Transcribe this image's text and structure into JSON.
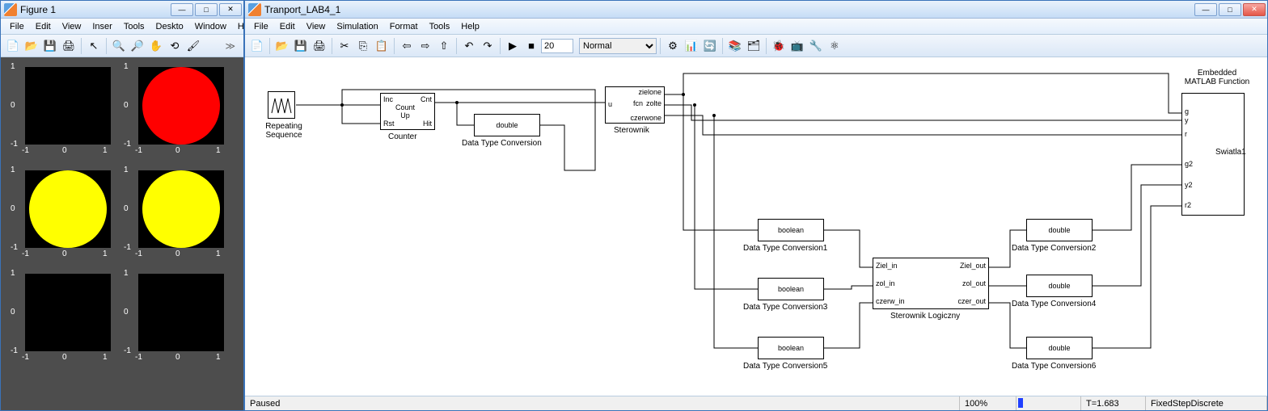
{
  "figure": {
    "title": "Figure 1",
    "menu": [
      "File",
      "Edit",
      "View",
      "Inser",
      "Tools",
      "Deskto",
      "Window",
      "Help"
    ],
    "ticks": {
      "x": [
        "-1",
        "0",
        "1"
      ],
      "y": [
        "-1",
        "0",
        "1"
      ]
    },
    "plots": [
      {
        "row": 0,
        "col": 0,
        "fill": "none"
      },
      {
        "row": 0,
        "col": 1,
        "fill": "#ff0000"
      },
      {
        "row": 1,
        "col": 0,
        "fill": "#ffff00"
      },
      {
        "row": 1,
        "col": 1,
        "fill": "#ffff00"
      },
      {
        "row": 2,
        "col": 0,
        "fill": "none"
      },
      {
        "row": 2,
        "col": 1,
        "fill": "none"
      }
    ]
  },
  "simulink": {
    "title": "Tranport_LAB4_1",
    "menu": [
      "File",
      "Edit",
      "View",
      "Simulation",
      "Format",
      "Tools",
      "Help"
    ],
    "stoptime": "20",
    "mode": "Normal",
    "status": {
      "state": "Paused",
      "zoom": "100%",
      "time": "T=1.683",
      "solver": "FixedStepDiscrete"
    },
    "blocks": {
      "repeating": "Repeating\nSequence",
      "counter": "Counter",
      "counter_ports": {
        "inc": "Inc",
        "rst": "Rst",
        "cnt": "Cnt",
        "hit": "Hit",
        "mid": "Count\nUp"
      },
      "dtc": "Data Type Conversion",
      "dtc_text": "double",
      "sterownik": "Sterownik",
      "sterownik_ports": {
        "u": "u",
        "z": "zielone",
        "zo": "zolte",
        "c": "czerwone",
        "fcn": "fcn"
      },
      "dtc1": "Data Type Conversion1",
      "dtc3": "Data Type Conversion3",
      "dtc5": "Data Type Conversion5",
      "bool": "boolean",
      "logic": "Sterownik Logiczny",
      "logic_ports": {
        "zi": "Ziel_in",
        "zoi": "zol_in",
        "ci": "czerw_in",
        "zo": "Ziel_out",
        "zoo": "zol_out",
        "co": "czer_out"
      },
      "dtc2": "Data Type Conversion2",
      "dtc4": "Data Type Conversion4",
      "dtc6": "Data Type Conversion6",
      "double": "double",
      "embed": "Embedded\nMATLAB Function",
      "swiatla": "Swiatla1",
      "embed_ports": {
        "g": "g",
        "y": "y",
        "r": "r",
        "g2": "g2",
        "y2": "y2",
        "r2": "r2"
      }
    }
  }
}
